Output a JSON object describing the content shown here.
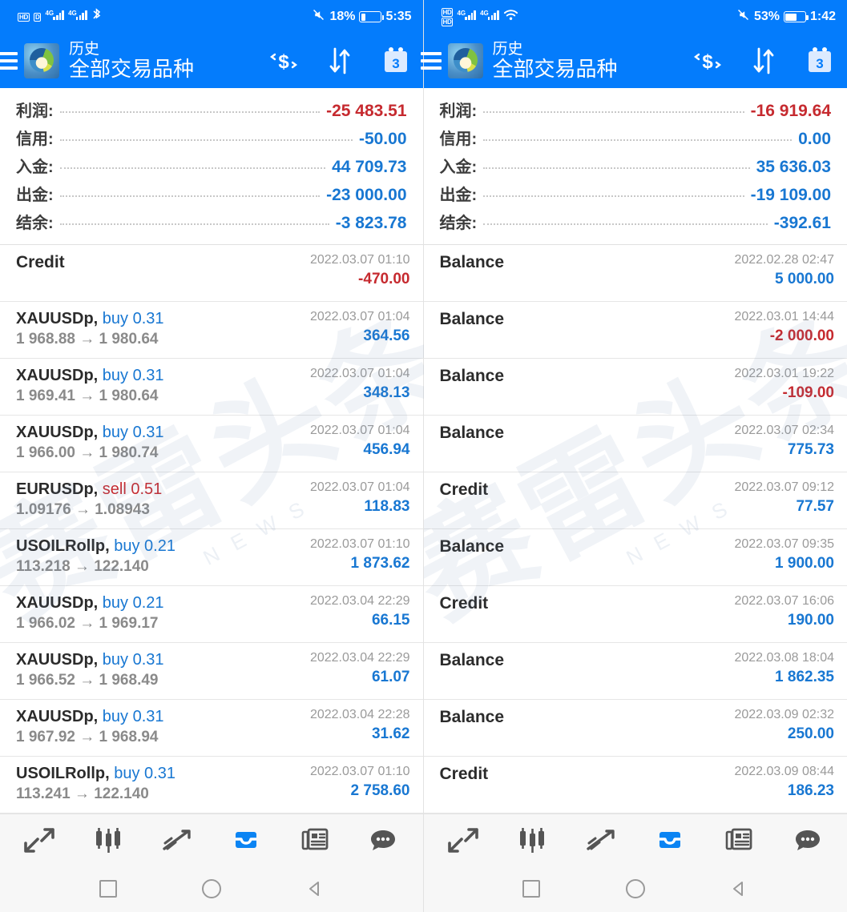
{
  "watermark": {
    "main": "赛雷头条",
    "sub": "NEWS"
  },
  "panels": [
    {
      "status": {
        "battery": "18%",
        "time": "5:35",
        "net1": "4G",
        "net2": "4G",
        "hd": "HD",
        "right_icon": "mute-icon"
      },
      "appbar": {
        "subtitle": "历史",
        "title": "全部交易品种"
      },
      "summary": [
        {
          "label": "利润:",
          "value": "-25 483.51",
          "negative": true
        },
        {
          "label": "信用:",
          "value": "-50.00",
          "negative": false
        },
        {
          "label": "入金:",
          "value": "44 709.73",
          "negative": false
        },
        {
          "label": "出金:",
          "value": "-23 000.00",
          "negative": false
        },
        {
          "label": "结余:",
          "value": "-3 823.78",
          "negative": false
        }
      ],
      "deals": [
        {
          "type": "Credit",
          "symbol": "",
          "side": "",
          "volume": "",
          "prices": "",
          "time": "2022.03.07 01:10",
          "amount": "-470.00",
          "negative": true
        },
        {
          "type": "",
          "symbol": "XAUUSDp,",
          "side": "buy",
          "volume": "0.31",
          "prices": "1 968.88 → 1 980.64",
          "time": "2022.03.07 01:04",
          "amount": "364.56",
          "negative": false
        },
        {
          "type": "",
          "symbol": "XAUUSDp,",
          "side": "buy",
          "volume": "0.31",
          "prices": "1 969.41 → 1 980.64",
          "time": "2022.03.07 01:04",
          "amount": "348.13",
          "negative": false
        },
        {
          "type": "",
          "symbol": "XAUUSDp,",
          "side": "buy",
          "volume": "0.31",
          "prices": "1 966.00 → 1 980.74",
          "time": "2022.03.07 01:04",
          "amount": "456.94",
          "negative": false
        },
        {
          "type": "",
          "symbol": "EURUSDp,",
          "side": "sell",
          "volume": "0.51",
          "prices": "1.09176 → 1.08943",
          "time": "2022.03.07 01:04",
          "amount": "118.83",
          "negative": false
        },
        {
          "type": "",
          "symbol": "USOILRollp,",
          "side": "buy",
          "volume": "0.21",
          "prices": "113.218 → 122.140",
          "time": "2022.03.07 01:10",
          "amount": "1 873.62",
          "negative": false
        },
        {
          "type": "",
          "symbol": "XAUUSDp,",
          "side": "buy",
          "volume": "0.21",
          "prices": "1 966.02 → 1 969.17",
          "time": "2022.03.04 22:29",
          "amount": "66.15",
          "negative": false
        },
        {
          "type": "",
          "symbol": "XAUUSDp,",
          "side": "buy",
          "volume": "0.31",
          "prices": "1 966.52 → 1 968.49",
          "time": "2022.03.04 22:29",
          "amount": "61.07",
          "negative": false
        },
        {
          "type": "",
          "symbol": "XAUUSDp,",
          "side": "buy",
          "volume": "0.31",
          "prices": "1 967.92 → 1 968.94",
          "time": "2022.03.04 22:28",
          "amount": "31.62",
          "negative": false
        },
        {
          "type": "",
          "symbol": "USOILRollp,",
          "side": "buy",
          "volume": "0.31",
          "prices": "113.241 → 122.140",
          "time": "2022.03.07 01:10",
          "amount": "2 758.60",
          "negative": false
        }
      ]
    },
    {
      "status": {
        "battery": "53%",
        "time": "1:42",
        "net1": "4G",
        "net2": "4G",
        "hd": "HD",
        "right_icon": "mute-icon"
      },
      "appbar": {
        "subtitle": "历史",
        "title": "全部交易品种"
      },
      "summary": [
        {
          "label": "利润:",
          "value": "-16 919.64",
          "negative": true
        },
        {
          "label": "信用:",
          "value": "0.00",
          "negative": false
        },
        {
          "label": "入金:",
          "value": "35 636.03",
          "negative": false
        },
        {
          "label": "出金:",
          "value": "-19 109.00",
          "negative": false
        },
        {
          "label": "结余:",
          "value": "-392.61",
          "negative": false
        }
      ],
      "deals": [
        {
          "type": "Balance",
          "symbol": "",
          "side": "",
          "volume": "",
          "prices": "",
          "time": "2022.02.28 02:47",
          "amount": "5 000.00",
          "negative": false
        },
        {
          "type": "Balance",
          "symbol": "",
          "side": "",
          "volume": "",
          "prices": "",
          "time": "2022.03.01 14:44",
          "amount": "-2 000.00",
          "negative": true
        },
        {
          "type": "Balance",
          "symbol": "",
          "side": "",
          "volume": "",
          "prices": "",
          "time": "2022.03.01 19:22",
          "amount": "-109.00",
          "negative": true
        },
        {
          "type": "Balance",
          "symbol": "",
          "side": "",
          "volume": "",
          "prices": "",
          "time": "2022.03.07 02:34",
          "amount": "775.73",
          "negative": false
        },
        {
          "type": "Credit",
          "symbol": "",
          "side": "",
          "volume": "",
          "prices": "",
          "time": "2022.03.07 09:12",
          "amount": "77.57",
          "negative": false
        },
        {
          "type": "Balance",
          "symbol": "",
          "side": "",
          "volume": "",
          "prices": "",
          "time": "2022.03.07 09:35",
          "amount": "1 900.00",
          "negative": false
        },
        {
          "type": "Credit",
          "symbol": "",
          "side": "",
          "volume": "",
          "prices": "",
          "time": "2022.03.07 16:06",
          "amount": "190.00",
          "negative": false
        },
        {
          "type": "Balance",
          "symbol": "",
          "side": "",
          "volume": "",
          "prices": "",
          "time": "2022.03.08 18:04",
          "amount": "1 862.35",
          "negative": false
        },
        {
          "type": "Balance",
          "symbol": "",
          "side": "",
          "volume": "",
          "prices": "",
          "time": "2022.03.09 02:32",
          "amount": "250.00",
          "negative": false
        },
        {
          "type": "Credit",
          "symbol": "",
          "side": "",
          "volume": "",
          "prices": "",
          "time": "2022.03.09 08:44",
          "amount": "186.23",
          "negative": false
        }
      ]
    }
  ],
  "appbar_icons": [
    {
      "name": "currency-exchange-icon",
      "label": "货币"
    },
    {
      "name": "sort-arrows-icon",
      "label": "排序"
    },
    {
      "name": "calendar-icon",
      "label": "3"
    }
  ],
  "tabs": [
    {
      "name": "quotes-icon",
      "label": "报价",
      "active": false
    },
    {
      "name": "charts-icon",
      "label": "图表",
      "active": false
    },
    {
      "name": "trade-icon",
      "label": "交易",
      "active": false
    },
    {
      "name": "history-inbox-icon",
      "label": "历史",
      "active": true
    },
    {
      "name": "news-icon",
      "label": "新闻",
      "active": false
    },
    {
      "name": "chat-icon",
      "label": "聊天",
      "active": false
    }
  ],
  "navbar": [
    {
      "name": "recents-button",
      "label": "最近"
    },
    {
      "name": "home-button",
      "label": "主页"
    },
    {
      "name": "back-button",
      "label": "返回"
    }
  ],
  "colors": {
    "accent": "#047cfc",
    "positive": "#1877d2",
    "negative": "#c62a2f",
    "muted": "#9a9a9a"
  }
}
